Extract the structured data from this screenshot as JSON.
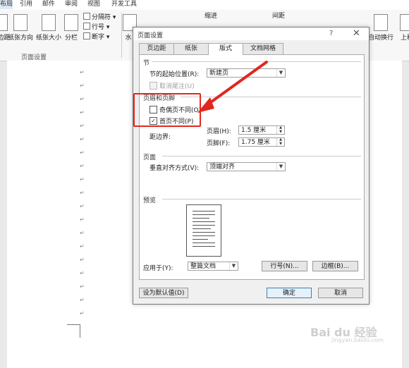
{
  "ribbon_tabs": [
    "布局",
    "引用",
    "邮件",
    "审阅",
    "视图",
    "开发工具"
  ],
  "ribbon": {
    "btn_margin_label": "页边距",
    "btn_orientation_label": "纸张方向",
    "btn_size_label": "纸张大小",
    "btn_columns_label": "分栏",
    "small_breaks": "分隔符",
    "small_line_numbers": "行号",
    "small_hyphenation": "断字",
    "btn_watermark": "水",
    "group_page_setup": "页面设置",
    "indent_label": "缩进",
    "spacing_label": "间距",
    "wrap_label": "自动换行",
    "up_label": "上移"
  },
  "dialog": {
    "title": "页面设置",
    "help": "?",
    "close": "✕",
    "tabs": [
      "页边距",
      "纸张",
      "版式",
      "文档网格"
    ],
    "active_tab": 2,
    "section_label": "节",
    "section_start_label": "节的起始位置(R):",
    "section_start_value": "新建页",
    "cancel_endnotes_label": "取消尾注(U)",
    "header_footer_label": "页眉和页脚",
    "odd_even_label": "奇偶页不同(O)",
    "odd_even_checked": false,
    "first_page_label": "首页不同(P)",
    "first_page_checked": true,
    "from_edge_label": "距边界:",
    "header_label": "页眉(H):",
    "header_value": "1.5 厘米",
    "footer_label": "页脚(F):",
    "footer_value": "1.75 厘米",
    "page_label": "页面",
    "valign_label": "垂直对齐方式(V):",
    "valign_value": "顶端对齐",
    "preview_label": "预览",
    "apply_label": "应用于(Y):",
    "apply_value": "整篇文档",
    "line_numbers_button": "行号(N)...",
    "borders_button": "边框(B)...",
    "set_default_button": "设为默认值(D)",
    "ok_button": "确定",
    "cancel_button": "取消"
  },
  "doc": {
    "para_mark": "↵"
  },
  "watermark": {
    "brand": "Bai du 经验",
    "url": "jingyan.baidu.com"
  },
  "colors": {
    "highlight": "#e0281e"
  }
}
